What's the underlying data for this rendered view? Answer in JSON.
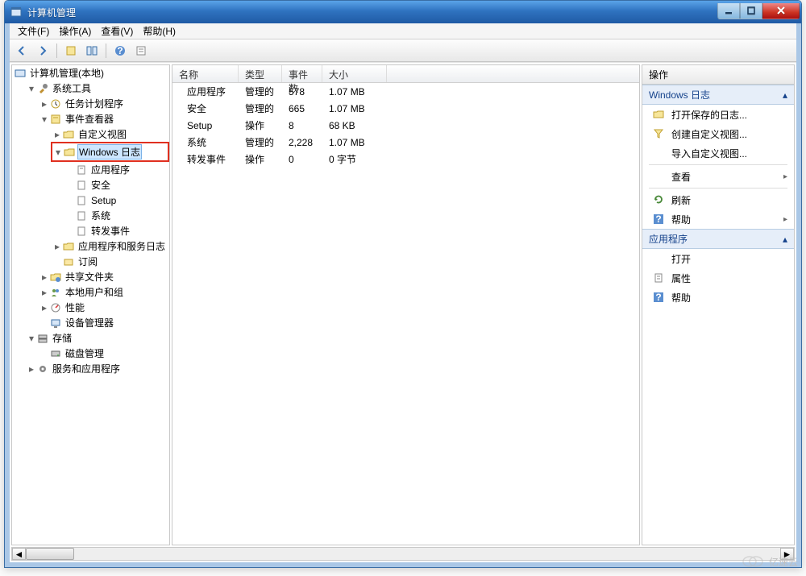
{
  "title": "计算机管理",
  "menu": {
    "file": "文件(F)",
    "action": "操作(A)",
    "view": "查看(V)",
    "help": "帮助(H)"
  },
  "tree": {
    "root": "计算机管理(本地)",
    "system_tools": "系统工具",
    "task_scheduler": "任务计划程序",
    "event_viewer": "事件查看器",
    "custom_views": "自定义视图",
    "windows_logs": "Windows 日志",
    "app_log": "应用程序",
    "security_log": "安全",
    "setup_log": "Setup",
    "system_log": "系统",
    "forwarded_log": "转发事件",
    "app_services": "应用程序和服务日志",
    "subscriptions": "订阅",
    "shared_folders": "共享文件夹",
    "local_users": "本地用户和组",
    "performance": "性能",
    "device_mgr": "设备管理器",
    "storage": "存储",
    "disk_mgr": "磁盘管理",
    "services_apps": "服务和应用程序"
  },
  "list": {
    "col_name": "名称",
    "col_type": "类型",
    "col_count": "事件数",
    "col_size": "大小",
    "rows": [
      {
        "name": "应用程序",
        "type": "管理的",
        "count": "578",
        "size": "1.07 MB"
      },
      {
        "name": "安全",
        "type": "管理的",
        "count": "665",
        "size": "1.07 MB"
      },
      {
        "name": "Setup",
        "type": "操作",
        "count": "8",
        "size": "68 KB"
      },
      {
        "name": "系统",
        "type": "管理的",
        "count": "2,228",
        "size": "1.07 MB"
      },
      {
        "name": "转发事件",
        "type": "操作",
        "count": "0",
        "size": "0 字节"
      }
    ]
  },
  "actions": {
    "title": "操作",
    "sec_win": "Windows 日志",
    "open_saved": "打开保存的日志...",
    "create_view": "创建自定义视图...",
    "import_view": "导入自定义视图...",
    "view": "查看",
    "refresh": "刷新",
    "help": "帮助",
    "sec_app": "应用程序",
    "open": "打开",
    "props": "属性",
    "help2": "帮助"
  },
  "watermark": "亿速云"
}
